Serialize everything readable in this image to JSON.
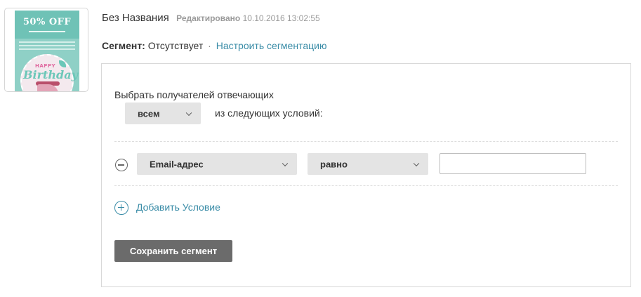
{
  "thumbnail": {
    "offer_text": "50% OFF",
    "happy_text": "HAPPY",
    "birthday_text": "Birthday"
  },
  "header": {
    "title": "Без Названия",
    "edited_label": "Редактировано",
    "edited_date": "10.10.2016 13:02:55"
  },
  "segment": {
    "label": "Сегмент:",
    "value": "Отсутствует",
    "separator": "·",
    "configure_link": "Настроить сегментацию"
  },
  "panel": {
    "choose_label": "Выбрать получателей отвечающих",
    "match_select": "всем",
    "conditions_label": "из следующих условий:",
    "condition": {
      "field_select": "Email-адрес",
      "operator_select": "равно",
      "value": ""
    },
    "add_condition_label": "Добавить Условие",
    "save_button": "Сохранить сегмент"
  },
  "colors": {
    "link": "#3a8ca7",
    "select_bg": "#e4e4e4",
    "save_bg": "#6b6b6b"
  },
  "icons": {
    "remove_condition": "minus-circle-icon",
    "add_condition": "plus-circle-icon",
    "dropdown": "chevron-down-icon"
  }
}
